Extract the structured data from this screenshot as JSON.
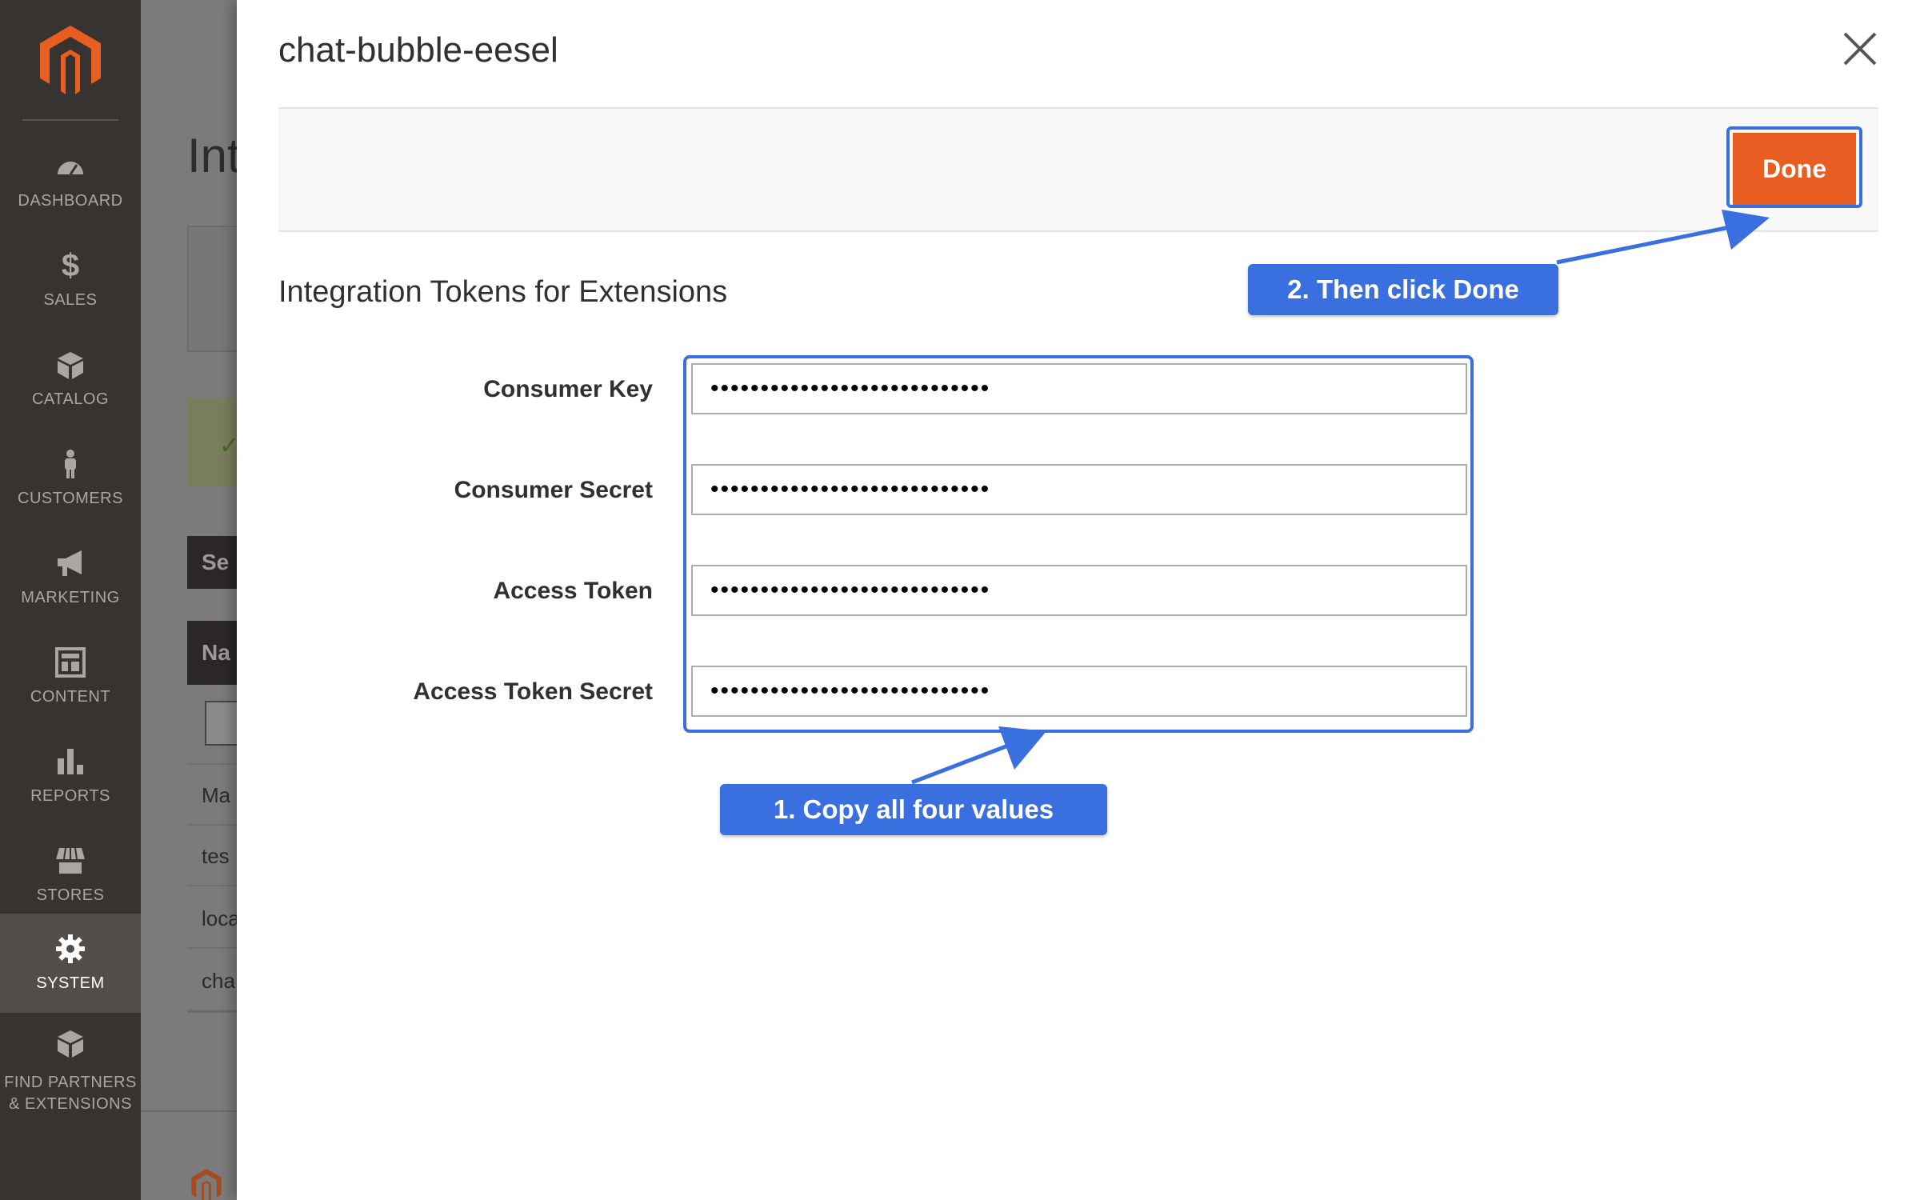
{
  "sidebar": {
    "items": [
      {
        "label": "DASHBOARD",
        "icon": "dashboard-icon"
      },
      {
        "label": "SALES",
        "icon": "dollar-icon"
      },
      {
        "label": "CATALOG",
        "icon": "catalog-box-icon"
      },
      {
        "label": "CUSTOMERS",
        "icon": "customer-person-icon"
      },
      {
        "label": "MARKETING",
        "icon": "megaphone-icon"
      },
      {
        "label": "CONTENT",
        "icon": "content-layout-icon"
      },
      {
        "label": "REPORTS",
        "icon": "bar-chart-icon"
      },
      {
        "label": "STORES",
        "icon": "store-icon"
      },
      {
        "label": "SYSTEM",
        "icon": "gear-icon",
        "active": true
      },
      {
        "label_line1": "FIND PARTNERS",
        "label_line2": "& EXTENSIONS",
        "icon": "extensions-icon"
      }
    ]
  },
  "background_page": {
    "title": "Int",
    "button": "Se",
    "table_header": "Na",
    "rows": [
      "Ma",
      "tes",
      "loca",
      "cha"
    ]
  },
  "modal": {
    "title": "chat-bubble-eesel",
    "done_label": "Done",
    "section_title": "Integration Tokens for Extensions",
    "fields": [
      {
        "label": "Consumer Key",
        "value": "••••••••••••••••••••••••••••"
      },
      {
        "label": "Consumer Secret",
        "value": "••••••••••••••••••••••••••••"
      },
      {
        "label": "Access Token",
        "value": "••••••••••••••••••••••••••••"
      },
      {
        "label": "Access Token Secret",
        "value": "••••••••••••••••••••••••••••"
      }
    ]
  },
  "annotations": {
    "callout_done": "2. Then click Done",
    "callout_copy": "1. Copy all four values",
    "color": "#3a6fe0"
  },
  "colors": {
    "sidebar_bg": "#373330",
    "accent_orange": "#e85d22",
    "magento_logo": "#e85d22"
  }
}
